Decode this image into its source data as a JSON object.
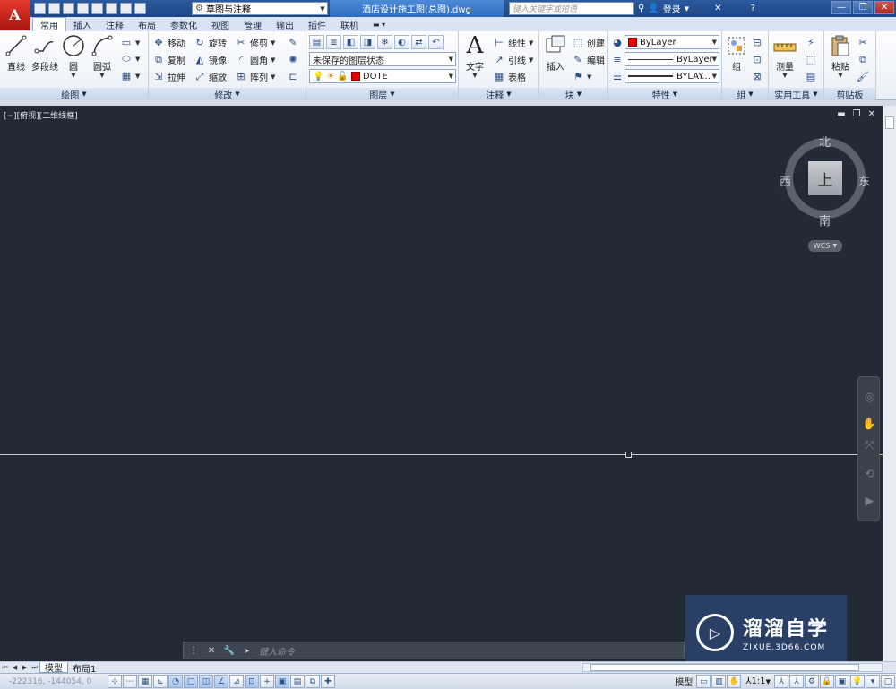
{
  "app": {
    "logo_letter": "A"
  },
  "title_bar": {
    "workspace": "草图与注释",
    "document_title": "酒店设计施工图(总图).dwg",
    "search_placeholder": "键入关键字或短语",
    "login_label": "登录"
  },
  "ribbon_tabs": [
    {
      "label": "常用",
      "active": true
    },
    {
      "label": "插入"
    },
    {
      "label": "注释"
    },
    {
      "label": "布局"
    },
    {
      "label": "参数化"
    },
    {
      "label": "视图"
    },
    {
      "label": "管理"
    },
    {
      "label": "输出"
    },
    {
      "label": "插件"
    },
    {
      "label": "联机"
    }
  ],
  "panels": {
    "draw": {
      "title": "绘图",
      "line": "直线",
      "polyline": "多段线",
      "circle": "圆",
      "arc": "圆弧"
    },
    "modify": {
      "title": "修改",
      "move": "移动",
      "rotate": "旋转",
      "trim": "修剪",
      "copy": "复制",
      "mirror": "镜像",
      "fillet": "圆角",
      "stretch": "拉伸",
      "scale": "缩放",
      "array": "阵列"
    },
    "layers": {
      "title": "图层",
      "state": "未保存的图层状态",
      "current_layer": "DOTE"
    },
    "annotation": {
      "title": "注释",
      "text": "文字",
      "dimension": "线性",
      "leader": "引线",
      "table": "表格"
    },
    "block": {
      "title": "块",
      "insert": "插入",
      "create": "创建",
      "edit": "编辑"
    },
    "properties": {
      "title": "特性",
      "color": "ByLayer",
      "linetype": "ByLayer",
      "lineweight": "BYLAY..."
    },
    "groups": {
      "title": "组",
      "group": "组"
    },
    "utilities": {
      "title": "实用工具",
      "measure": "测量"
    },
    "clipboard": {
      "title": "剪贴板",
      "paste": "粘贴"
    }
  },
  "viewport": {
    "label": "[−][俯视][二维线框]"
  },
  "viewcube": {
    "north": "北",
    "south": "南",
    "east": "东",
    "west": "西",
    "face": "上",
    "wcs": "WCS"
  },
  "command_line": {
    "placeholder": "键入命令"
  },
  "layout_tabs": [
    {
      "label": "模型",
      "active": true
    },
    {
      "label": "布局1"
    }
  ],
  "status_bar": {
    "coords": "-222316, -144054, 0",
    "model_label": "模型",
    "scale": "1:1"
  },
  "watermark": {
    "name": "溜溜自学",
    "url": "ZIXUE.3D66.COM"
  }
}
